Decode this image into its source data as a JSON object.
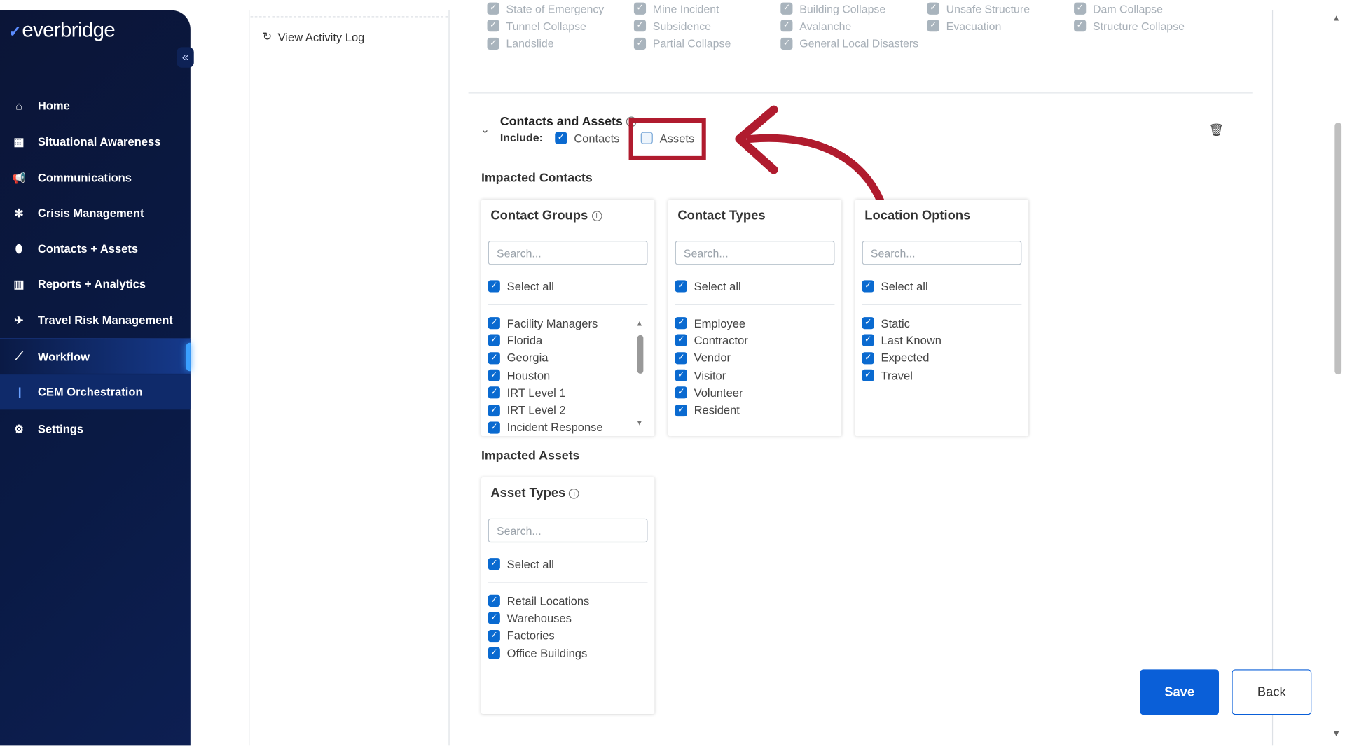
{
  "brand": {
    "logo": "everbridge"
  },
  "sidebar": {
    "items": [
      {
        "label": "Home",
        "icon": "home-icon"
      },
      {
        "label": "Situational Awareness",
        "icon": "map-icon"
      },
      {
        "label": "Communications",
        "icon": "megaphone-icon"
      },
      {
        "label": "Crisis Management",
        "icon": "crisis-icon"
      },
      {
        "label": "Contacts + Assets",
        "icon": "location-pin-icon"
      },
      {
        "label": "Reports + Analytics",
        "icon": "bar-chart-icon"
      },
      {
        "label": "Travel Risk Management",
        "icon": "airplane-icon"
      },
      {
        "label": "Workflow",
        "icon": "line-chart-icon"
      },
      {
        "label": "CEM Orchestration"
      },
      {
        "label": "Settings",
        "icon": "gear-icon"
      }
    ],
    "active": "Workflow"
  },
  "left_panel": {
    "activity_log": "View Activity Log"
  },
  "incident_types": [
    [
      "State of Emergency",
      "Mine Incident",
      "Building Collapse",
      "Unsafe Structure",
      "Dam Collapse"
    ],
    [
      "Tunnel Collapse",
      "Subsidence",
      "Avalanche",
      "Evacuation",
      "Structure Collapse"
    ],
    [
      "Landslide",
      "Partial Collapse",
      "General Local Disasters"
    ]
  ],
  "section": {
    "title": "Contacts and Assets",
    "include_label": "Include:",
    "contacts_label": "Contacts",
    "contacts_checked": true,
    "assets_label": "Assets",
    "assets_checked": false
  },
  "impacted_contacts": {
    "heading": "Impacted Contacts",
    "cards": [
      {
        "title": "Contact Groups",
        "info": true,
        "placeholder": "Search...",
        "select_all": "Select all",
        "items": [
          "Facility Managers",
          "Florida",
          "Georgia",
          "Houston",
          "IRT Level 1",
          "IRT Level 2",
          "Incident Response"
        ]
      },
      {
        "title": "Contact Types",
        "info": false,
        "placeholder": "Search...",
        "select_all": "Select all",
        "items": [
          "Employee",
          "Contractor",
          "Vendor",
          "Visitor",
          "Volunteer",
          "Resident"
        ]
      },
      {
        "title": "Location Options",
        "info": false,
        "placeholder": "Search...",
        "select_all": "Select all",
        "items": [
          "Static",
          "Last Known",
          "Expected",
          "Travel"
        ]
      }
    ]
  },
  "impacted_assets": {
    "heading": "Impacted Assets",
    "card": {
      "title": "Asset Types",
      "placeholder": "Search...",
      "select_all": "Select all",
      "items": [
        "Retail Locations",
        "Warehouses",
        "Factories",
        "Office Buildings"
      ]
    }
  },
  "actions": {
    "save": "Save",
    "back": "Back"
  },
  "colors": {
    "accent": "#0a5fd8",
    "annotation": "#b01b2e",
    "sidebar": "#0a1a45"
  }
}
